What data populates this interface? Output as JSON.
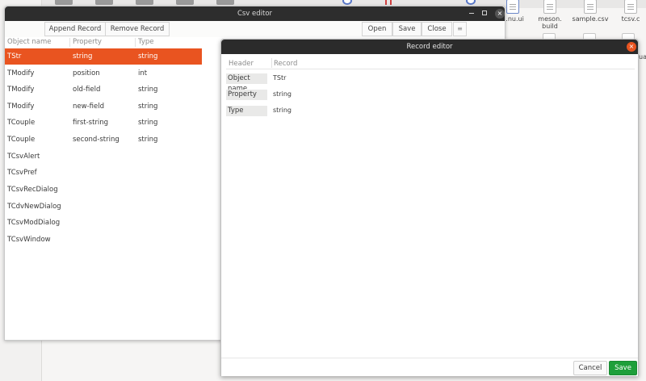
{
  "desktop": {
    "files": [
      {
        "name": "...nu.ui"
      },
      {
        "name": "meson.\nbuild"
      },
      {
        "name": "sample.csv"
      },
      {
        "name": "tcsv.c"
      }
    ],
    "partial_label": "ual"
  },
  "csv_editor": {
    "title": "Csv editor",
    "toolbar": {
      "append_label": "Append Record",
      "remove_label": "Remove Record",
      "open_label": "Open",
      "save_label": "Save",
      "close_label": "Close",
      "menu_icon": "hamburger-menu-icon"
    },
    "columns": [
      "Object name",
      "Property",
      "Type"
    ],
    "rows": [
      {
        "name": "TStr",
        "property": "string",
        "type": "string"
      },
      {
        "name": "TModify",
        "property": "position",
        "type": "int"
      },
      {
        "name": "TModify",
        "property": "old-field",
        "type": "string"
      },
      {
        "name": "TModify",
        "property": "new-field",
        "type": "string"
      },
      {
        "name": "TCouple",
        "property": "first-string",
        "type": "string"
      },
      {
        "name": "TCouple",
        "property": "second-string",
        "type": "string"
      },
      {
        "name": "TCsvAlert",
        "property": "",
        "type": ""
      },
      {
        "name": "TCsvPref",
        "property": "",
        "type": ""
      },
      {
        "name": "TCsvRecDialog",
        "property": "",
        "type": ""
      },
      {
        "name": "TCdvNewDialog",
        "property": "",
        "type": ""
      },
      {
        "name": "TCsvModDialog",
        "property": "",
        "type": ""
      },
      {
        "name": "TCsvWindow",
        "property": "",
        "type": ""
      }
    ],
    "selected_row": 0
  },
  "record_editor": {
    "title": "Record editor",
    "columns": [
      "Header",
      "Record"
    ],
    "fields": [
      {
        "header": "Object name",
        "value": "TStr"
      },
      {
        "header": "Property",
        "value": "string"
      },
      {
        "header": "Type",
        "value": "string"
      }
    ],
    "cancel_label": "Cancel",
    "save_label": "Save"
  },
  "colors": {
    "accent": "#e95420",
    "save_green": "#1e9f3a",
    "titlebar": "#2d2d2d"
  }
}
